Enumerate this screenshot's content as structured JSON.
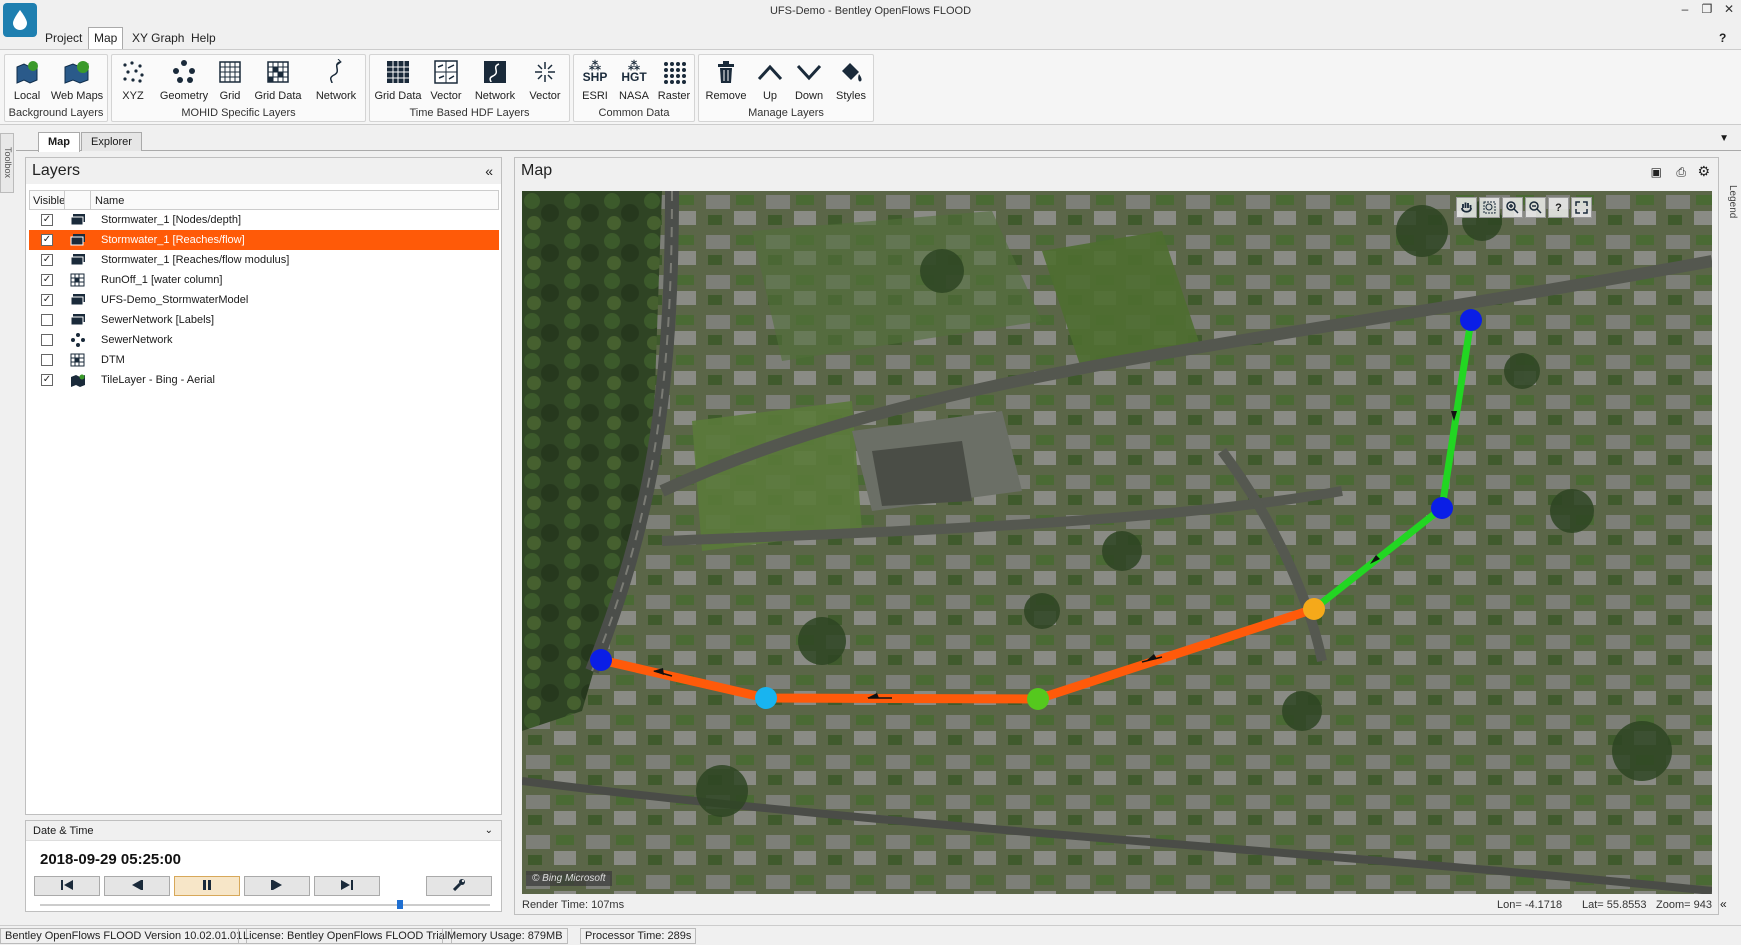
{
  "window": {
    "title": "UFS-Demo - Bentley OpenFlows FLOOD",
    "help": "?"
  },
  "menu": [
    "Project",
    "Map",
    "XY Graph",
    "Help"
  ],
  "ribbon": {
    "groups": [
      {
        "label": "Background Layers",
        "buttons": [
          "Local",
          "Web Maps"
        ]
      },
      {
        "label": "MOHID Specific Layers",
        "buttons": [
          "XYZ",
          "Geometry",
          "Grid",
          "Grid Data",
          "Network"
        ]
      },
      {
        "label": "Time Based HDF Layers",
        "buttons": [
          "Grid Data",
          "Vector",
          "Network",
          "Vector"
        ]
      },
      {
        "label": "Common Data",
        "buttons": [
          "ESRI",
          "NASA",
          "Raster"
        ]
      },
      {
        "label": "Manage Layers",
        "buttons": [
          "Remove",
          "Up",
          "Down",
          "Styles"
        ]
      }
    ],
    "icon_text": {
      "shp": "SHP",
      "hgt": "HGT"
    }
  },
  "doc_tabs": [
    "Map",
    "Explorer"
  ],
  "toolbox_label": "Toolbox",
  "layers": {
    "title": "Layers",
    "columns": {
      "visible": "Visible",
      "name": "Name"
    },
    "rows": [
      {
        "name": "Stormwater_1 [Nodes/depth]",
        "checked": true,
        "selected": false,
        "icon": "layer-stack-icon"
      },
      {
        "name": "Stormwater_1 [Reaches/flow]",
        "checked": true,
        "selected": true,
        "icon": "layer-stack-icon"
      },
      {
        "name": "Stormwater_1 [Reaches/flow modulus]",
        "checked": true,
        "selected": false,
        "icon": "layer-stack-icon"
      },
      {
        "name": "RunOff_1 [water column]",
        "checked": true,
        "selected": false,
        "icon": "grid-layer-icon"
      },
      {
        "name": "UFS-Demo_StormwaterModel",
        "checked": true,
        "selected": false,
        "icon": "layer-stack-icon"
      },
      {
        "name": "SewerNetwork [Labels]",
        "checked": false,
        "selected": false,
        "icon": "layer-stack-icon"
      },
      {
        "name": "SewerNetwork",
        "checked": false,
        "selected": false,
        "icon": "network-layer-icon"
      },
      {
        "name": "DTM",
        "checked": false,
        "selected": false,
        "icon": "grid-layer-icon"
      },
      {
        "name": "TileLayer - Bing - Aerial",
        "checked": true,
        "selected": false,
        "icon": "tile-layer-icon"
      }
    ]
  },
  "datetime": {
    "title": "Date & Time",
    "value": "2018-09-29 05:25:00",
    "slider_fraction": 0.8
  },
  "map": {
    "title": "Map",
    "attribution": "© Bing Microsoft",
    "render_time": "Render Time: 107ms",
    "lon": "Lon= -4.1718",
    "lat": "Lat= 55.8553",
    "zoom": "Zoom= 943",
    "legend_label": "Legend"
  },
  "status": {
    "version": "Bentley OpenFlows FLOOD Version 10.02.01.01",
    "license": "License: Bentley OpenFlows FLOOD Trial",
    "memory": "Memory Usage: 879MB",
    "processor": "Processor Time: 289s"
  },
  "colors": {
    "selection": "#ff5a08",
    "reach_orange": "#ff5a0a",
    "reach_green": "#22d622",
    "node_blue": "#0a1ee6",
    "node_cyan": "#18b4f0",
    "node_green": "#55c81e",
    "node_amber": "#f5a91a"
  }
}
